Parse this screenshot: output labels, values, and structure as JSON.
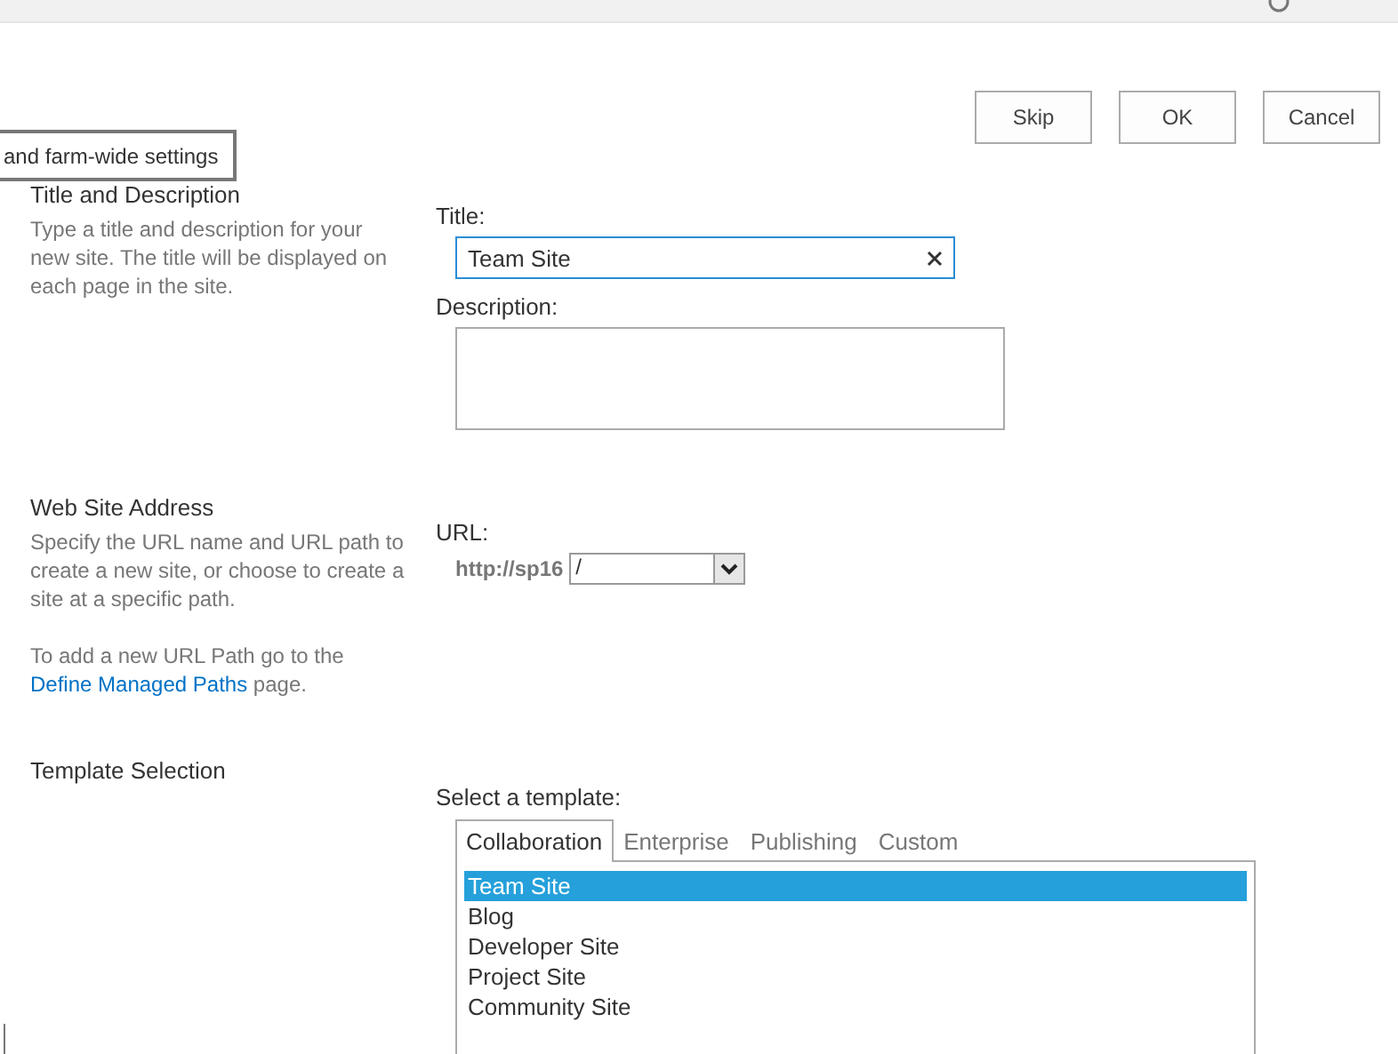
{
  "buttons": [
    {
      "label": "Skip"
    },
    {
      "label": "OK"
    },
    {
      "label": "Cancel"
    }
  ],
  "tooltip": "and farm-wide settings",
  "sections": [
    {
      "kind": "title",
      "heading": "Title and Description",
      "description": "Type a title and description for your new site. The title will be displayed on each page in the site.",
      "title_label": "Title:",
      "title_value": "Team Site",
      "description_label": "Description:"
    },
    {
      "kind": "url",
      "heading": "Web Site Address",
      "description": "Specify the URL name and URL path to create a new site, or choose to create a site at a specific path.",
      "note_before": "To add a new URL Path go to the",
      "note_link": "Define Managed Paths",
      "note_after": "page.",
      "url_label": "URL:",
      "url_prefix": "http://sp16",
      "url_path": "/"
    },
    {
      "kind": "template",
      "heading": "Template Selection",
      "select_label": "Select a template:",
      "tabs": [
        {
          "label": "Collaboration",
          "selected": true
        },
        {
          "label": "Enterprise",
          "selected": false
        },
        {
          "label": "Publishing",
          "selected": false
        },
        {
          "label": "Custom",
          "selected": false
        }
      ],
      "templates": [
        {
          "label": "Team Site",
          "selected": true
        },
        {
          "label": "Blog",
          "selected": false
        },
        {
          "label": "Developer Site",
          "selected": false
        },
        {
          "label": "Project Site",
          "selected": false
        },
        {
          "label": "Community Site",
          "selected": false
        }
      ]
    }
  ]
}
